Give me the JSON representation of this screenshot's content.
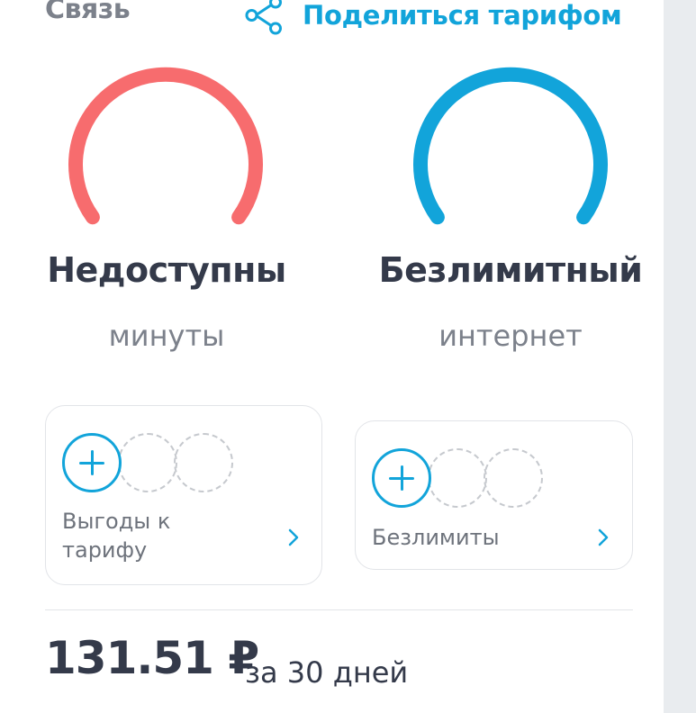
{
  "header": {
    "title": "Связь",
    "share_label": "Поделиться тарифом"
  },
  "gauges": [
    {
      "value": "Недоступны",
      "unit": "минуты",
      "color": "#f76c6e"
    },
    {
      "value": "Безлимитный",
      "unit": "интернет",
      "color": "#12a4da"
    }
  ],
  "options": [
    {
      "label": "Выгоды к тарифу",
      "label_line1": "Выгоды к",
      "label_line2": "тарифу"
    },
    {
      "label": "Безлимиты"
    }
  ],
  "price": {
    "amount": "131.51 ₽",
    "period": "за 30 дней"
  },
  "colors": {
    "accent": "#12a4da",
    "minutes_gauge": "#f76c6e",
    "text_primary": "#343a4a",
    "text_secondary": "#7c818b"
  },
  "icons": {
    "share": "share-icon",
    "add": "plus-circle-icon",
    "chevron": "chevron-right-icon"
  }
}
